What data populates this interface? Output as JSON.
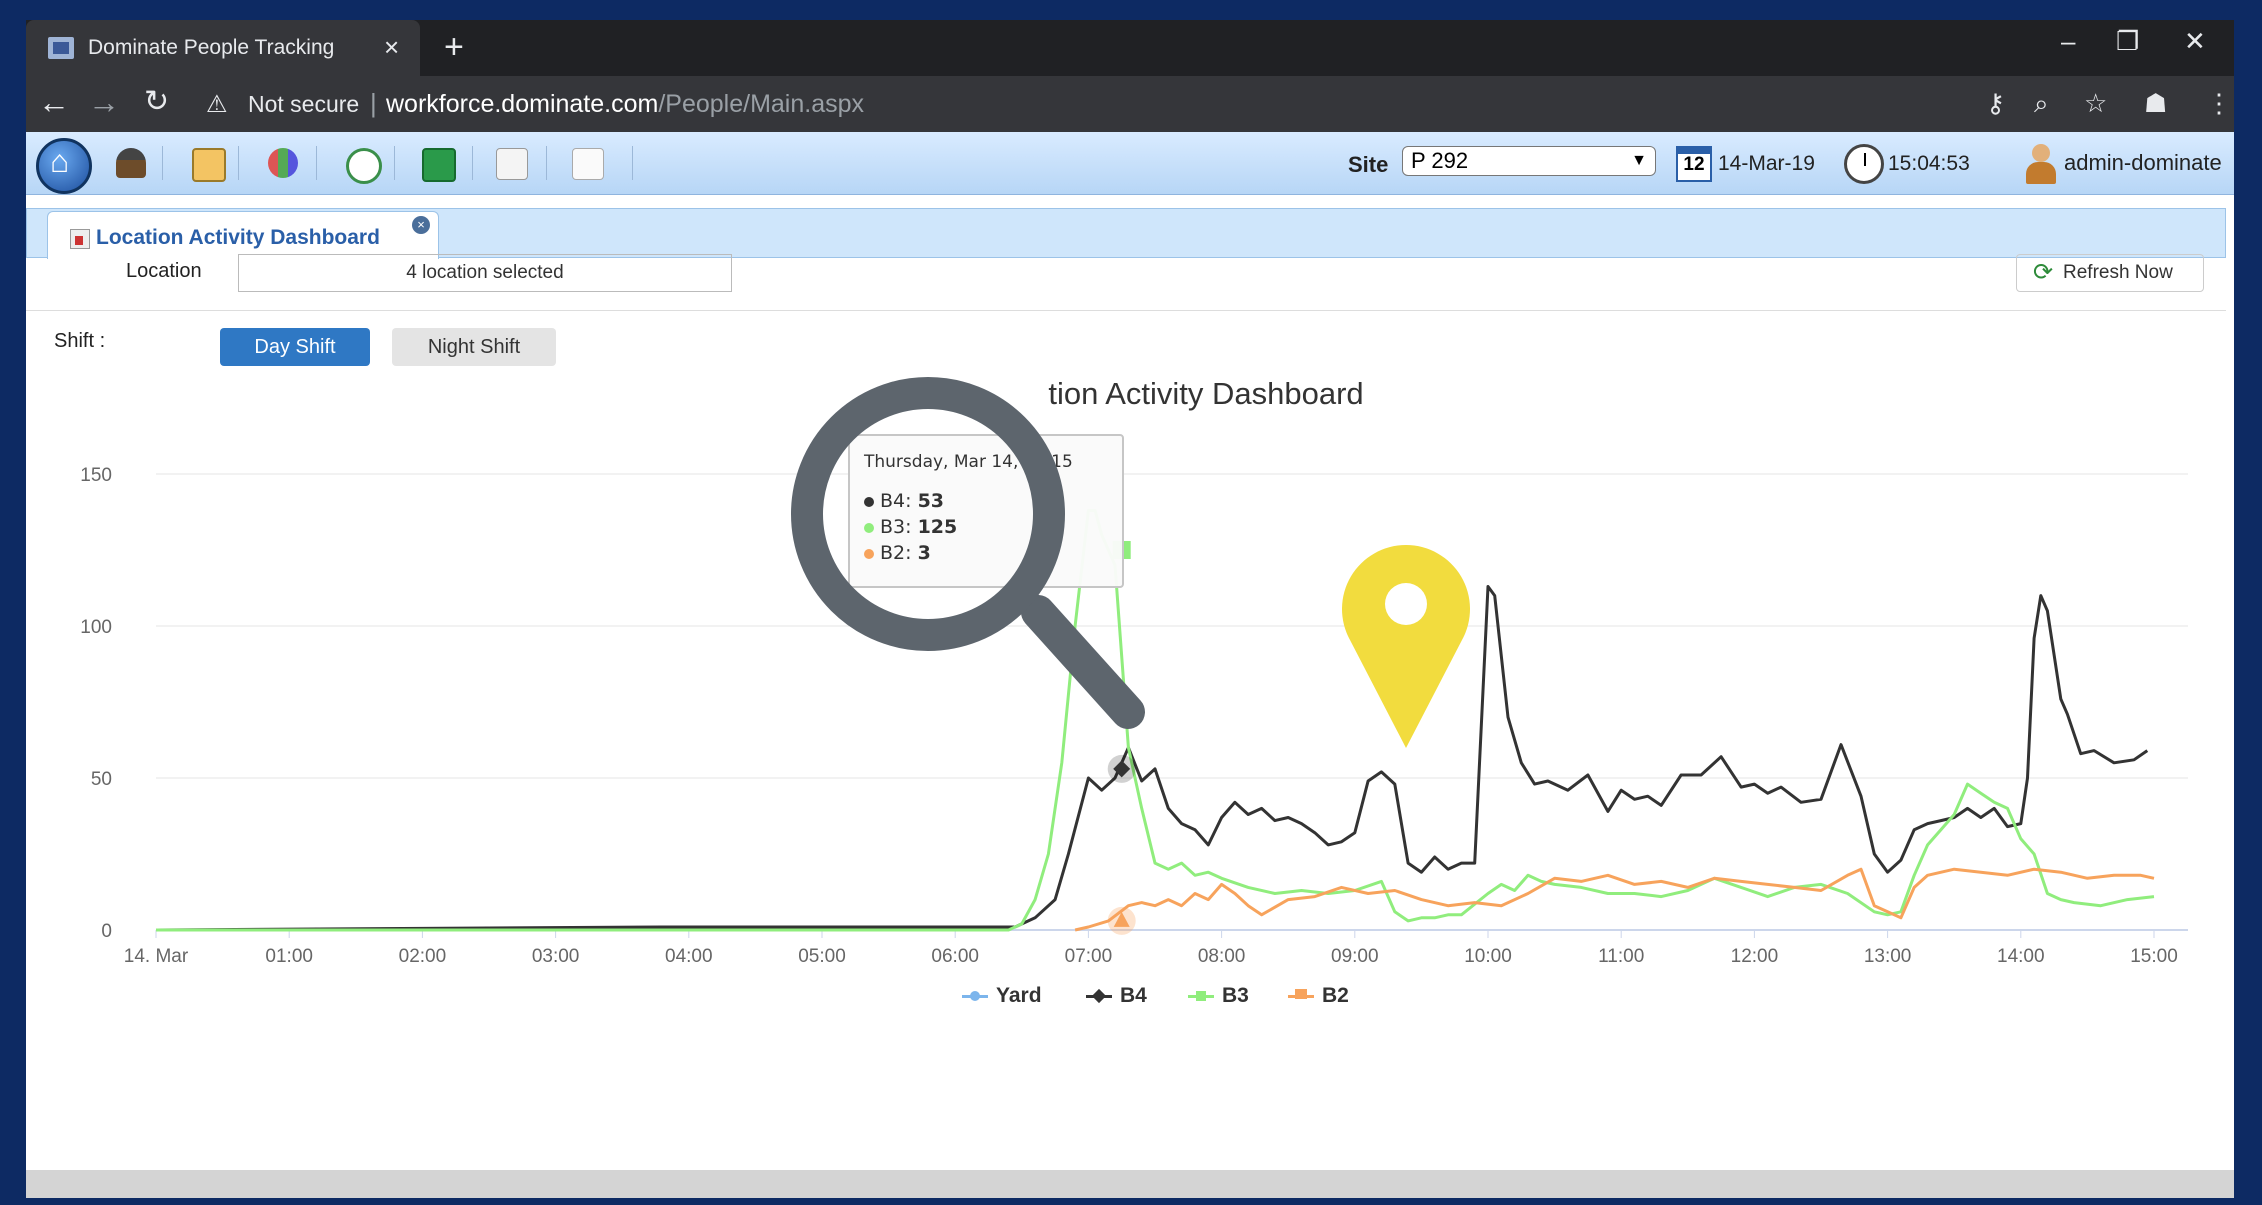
{
  "browser": {
    "tab_title": "Dominate People Tracking",
    "tab_close": "×",
    "new_tab": "+",
    "not_secure": "Not secure",
    "url_host": "workforce.dominate.com",
    "url_path": "/People/Main.aspx",
    "window_controls": [
      "–",
      "❐",
      "✕"
    ]
  },
  "toolbar": {
    "site_label": "Site",
    "site_value": "P 292",
    "calendar_day": "12",
    "date": "14-Mar-19",
    "time": "15:04:53",
    "user": "admin-dominate"
  },
  "page_tab": {
    "label": "Location Activity Dashboard"
  },
  "filters": {
    "location_label": "Location",
    "location_value": "4 location selected",
    "refresh_label": "Refresh Now",
    "shift_label": "Shift :",
    "day_shift": "Day Shift",
    "night_shift": "Night Shift"
  },
  "tooltip": {
    "header": "Thursday, Mar 14, 07:15",
    "rows": [
      {
        "series": "B4",
        "value": "53",
        "color": "#333333"
      },
      {
        "series": "B3",
        "value": "125",
        "color": "#90ed7d"
      },
      {
        "series": "B2",
        "value": "3",
        "color": "#f7a35c"
      }
    ]
  },
  "chart_data": {
    "type": "line",
    "title": "Location Activity Dashboard",
    "title_visible": "tion Activity Dashboard",
    "y_ticks": [
      "0",
      "50",
      "100",
      "150"
    ],
    "ylim": [
      0,
      160
    ],
    "x_ticks": [
      "14. Mar",
      "01:00",
      "02:00",
      "03:00",
      "04:00",
      "05:00",
      "06:00",
      "07:00",
      "08:00",
      "09:00",
      "10:00",
      "11:00",
      "12:00",
      "13:00",
      "14:00",
      "15:00"
    ],
    "xlim_hours": [
      0,
      15.1
    ],
    "legend": [
      "Yard",
      "B4",
      "B3",
      "B2"
    ],
    "legend_position": "bottom-center",
    "series": [
      {
        "name": "Yard",
        "color": "#7cb5ec",
        "x": [],
        "y": []
      },
      {
        "name": "B4",
        "color": "#333333",
        "x": [
          0,
          3.8,
          6.45,
          6.6,
          6.75,
          6.85,
          7.0,
          7.1,
          7.2,
          7.3,
          7.4,
          7.5,
          7.6,
          7.7,
          7.8,
          7.9,
          8.0,
          8.1,
          8.2,
          8.3,
          8.4,
          8.5,
          8.6,
          8.7,
          8.8,
          8.9,
          9.0,
          9.1,
          9.2,
          9.3,
          9.4,
          9.5,
          9.6,
          9.7,
          9.8,
          9.9,
          10.0,
          10.05,
          10.15,
          10.25,
          10.35,
          10.45,
          10.6,
          10.75,
          10.9,
          11.0,
          11.1,
          11.2,
          11.3,
          11.45,
          11.6,
          11.75,
          11.9,
          12.0,
          12.1,
          12.2,
          12.35,
          12.5,
          12.65,
          12.8,
          12.9,
          13.0,
          13.1,
          13.2,
          13.3,
          13.4,
          13.5,
          13.6,
          13.7,
          13.8,
          13.9,
          14.0,
          14.05,
          14.1,
          14.15,
          14.2,
          14.3,
          14.35,
          14.45,
          14.55,
          14.7,
          14.85,
          14.95
        ],
        "y": [
          0,
          1,
          1,
          4,
          10,
          25,
          50,
          46,
          50,
          60,
          49,
          53,
          40,
          35,
          33,
          28,
          37,
          42,
          38,
          40,
          36,
          37,
          35,
          32,
          28,
          29,
          32,
          49,
          52,
          48,
          22,
          19,
          24,
          20,
          22,
          22,
          113,
          110,
          70,
          55,
          48,
          49,
          46,
          51,
          39,
          46,
          43,
          44,
          41,
          51,
          51,
          57,
          47,
          48,
          45,
          47,
          42,
          43,
          61,
          44,
          25,
          19,
          23,
          33,
          35,
          36,
          37,
          40,
          37,
          40,
          34,
          35,
          50,
          96,
          110,
          105,
          76,
          71,
          58,
          59,
          55,
          56,
          59
        ]
      },
      {
        "name": "B3",
        "color": "#90ed7d",
        "x": [
          0,
          6.4,
          6.5,
          6.6,
          6.7,
          6.8,
          6.9,
          7.0,
          7.05,
          7.1,
          7.15,
          7.2,
          7.25,
          7.3,
          7.4,
          7.5,
          7.6,
          7.7,
          7.8,
          7.9,
          8.0,
          8.2,
          8.4,
          8.6,
          8.8,
          9.0,
          9.2,
          9.3,
          9.4,
          9.5,
          9.6,
          9.7,
          9.8,
          10.0,
          10.1,
          10.2,
          10.3,
          10.4,
          10.5,
          10.7,
          10.9,
          11.1,
          11.3,
          11.5,
          11.7,
          11.9,
          12.1,
          12.3,
          12.5,
          12.7,
          12.9,
          13.0,
          13.1,
          13.2,
          13.3,
          13.4,
          13.5,
          13.6,
          13.7,
          13.8,
          13.9,
          14.0,
          14.1,
          14.2,
          14.3,
          14.4,
          14.6,
          14.8,
          15.0
        ],
        "y": [
          0,
          0,
          2,
          10,
          25,
          55,
          100,
          138,
          138,
          130,
          125,
          120,
          90,
          60,
          40,
          22,
          20,
          22,
          18,
          19,
          17,
          14,
          12,
          13,
          12,
          13,
          16,
          6,
          3,
          4,
          4,
          5,
          5,
          12,
          15,
          13,
          18,
          16,
          15,
          14,
          12,
          12,
          11,
          13,
          17,
          14,
          11,
          14,
          15,
          12,
          6,
          5,
          6,
          18,
          28,
          33,
          38,
          48,
          45,
          42,
          40,
          30,
          25,
          12,
          10,
          9,
          8,
          10,
          11
        ]
      },
      {
        "name": "B2",
        "color": "#f7a35c",
        "x": [
          6.9,
          7.0,
          7.15,
          7.3,
          7.4,
          7.5,
          7.6,
          7.7,
          7.8,
          7.9,
          8.0,
          8.1,
          8.2,
          8.3,
          8.5,
          8.7,
          8.9,
          9.1,
          9.3,
          9.5,
          9.7,
          9.9,
          10.1,
          10.3,
          10.5,
          10.7,
          10.9,
          11.1,
          11.3,
          11.5,
          11.7,
          11.9,
          12.1,
          12.3,
          12.5,
          12.7,
          12.8,
          12.9,
          13.0,
          13.1,
          13.2,
          13.3,
          13.5,
          13.7,
          13.9,
          14.1,
          14.3,
          14.5,
          14.7,
          14.9,
          15.0
        ],
        "y": [
          0,
          1,
          3,
          8,
          9,
          8,
          10,
          8,
          12,
          10,
          15,
          12,
          8,
          5,
          10,
          11,
          14,
          12,
          13,
          10,
          8,
          9,
          8,
          12,
          17,
          16,
          18,
          15,
          16,
          14,
          17,
          16,
          15,
          14,
          13,
          18,
          20,
          8,
          6,
          4,
          14,
          18,
          20,
          19,
          18,
          20,
          19,
          17,
          18,
          18,
          17
        ]
      }
    ]
  }
}
